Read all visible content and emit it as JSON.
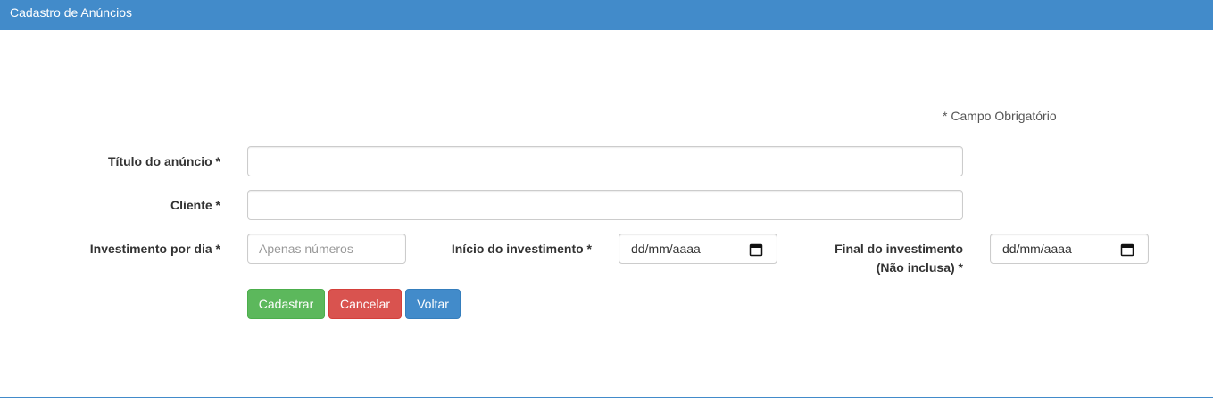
{
  "header": {
    "title": "Cadastro de Anúncios"
  },
  "form": {
    "required_note": "* Campo Obrigatório",
    "titulo": {
      "label": "Título do anúncio *",
      "value": ""
    },
    "cliente": {
      "label": "Cliente *",
      "value": ""
    },
    "investimento": {
      "label": "Investimento por dia *",
      "placeholder": "Apenas números",
      "value": ""
    },
    "inicio": {
      "label": "Início do investimento *",
      "placeholder": "dd/mm/aaaa",
      "icon": "calendar-icon"
    },
    "final": {
      "label_line1": "Final do investimento",
      "label_line2": "(Não inclusa) *",
      "placeholder": "dd/mm/aaaa",
      "icon": "calendar-icon"
    }
  },
  "actions": {
    "cadastrar": "Cadastrar",
    "cancelar": "Cancelar",
    "voltar": "Voltar"
  },
  "colors": {
    "primary": "#428bca",
    "success": "#5cb85c",
    "danger": "#d9534f"
  }
}
